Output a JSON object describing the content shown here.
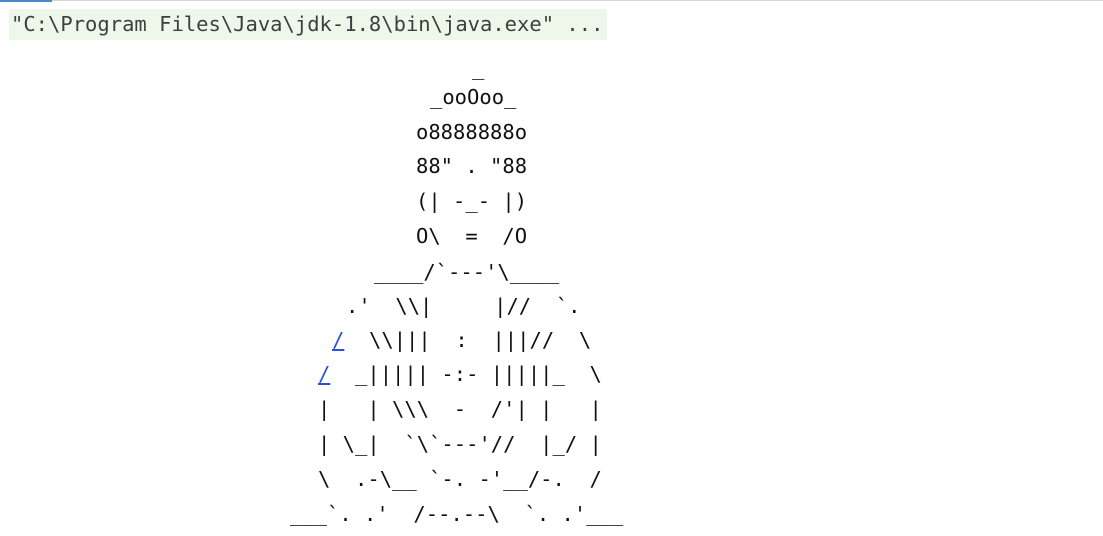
{
  "console": {
    "command": "\"C:\\Program Files\\Java\\jdk-1.8\\bin\\java.exe\" ...",
    "link_color": "#2a4fd6",
    "command_bg": "#edf7ea"
  },
  "art": {
    "l01": "_",
    "l02": "_ooOoo_",
    "l03": "o8888888o",
    "l04": "88\" . \"88",
    "l05": "(| -_- |)",
    "l06": "O\\  =  /O",
    "l07": "____/`---'\\____",
    "l08": ".'  \\\\|     |//  `.",
    "l09_link": "/",
    "l09_rest": "  \\\\|||  :  |||//  \\",
    "l10_link": "/",
    "l10_rest": "  _||||| -:- |||||_  \\",
    "l11": "|   | \\\\\\  -  /'| |   |",
    "l12": "| \\_|  `\\`---'//  |_/ |",
    "l13": "\\  .-\\__ `-. -'__/-.  /",
    "l14": "___`. .'  /--.--\\  `. .'___"
  }
}
